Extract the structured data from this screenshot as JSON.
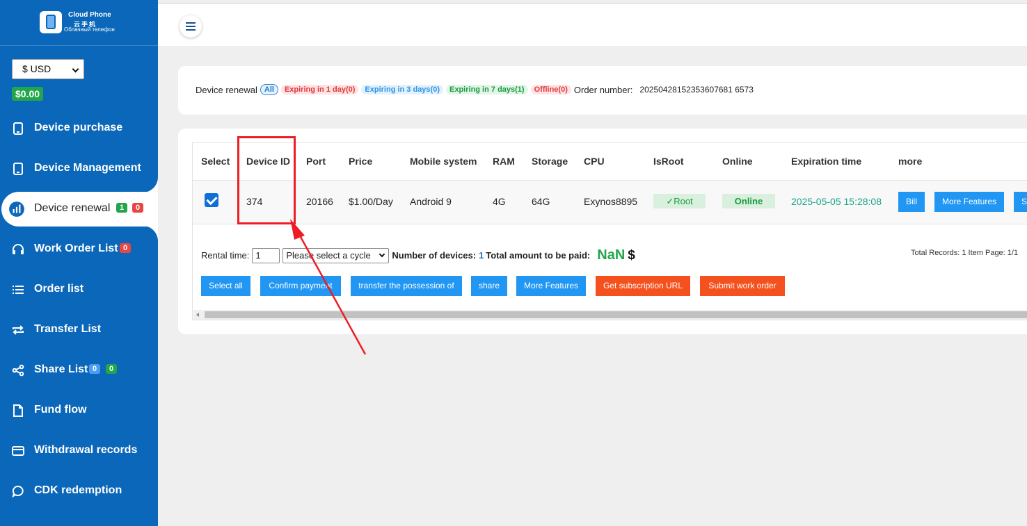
{
  "logo": {
    "line1": "Cloud Phone",
    "line2": "云手机",
    "line3": "Облачный телефон"
  },
  "sidebar": {
    "currency": "$ USD",
    "balance": "$0.00",
    "items": [
      {
        "label": "Device purchase",
        "icon": "tablet-icon"
      },
      {
        "label": "Device Management",
        "icon": "tablet-icon"
      },
      {
        "label": "Device renewal",
        "icon": "bar-chart-icon",
        "badges": [
          "1",
          "0"
        ]
      },
      {
        "label": "Work Order List",
        "icon": "headset-icon",
        "badges": [
          "0"
        ]
      },
      {
        "label": "Order list",
        "icon": "list-icon"
      },
      {
        "label": "Transfer List",
        "icon": "transfer-icon"
      },
      {
        "label": "Share List",
        "icon": "share-icon",
        "badges": [
          "0",
          "0"
        ]
      },
      {
        "label": "Fund flow",
        "icon": "file-icon"
      },
      {
        "label": "Withdrawal records",
        "icon": "card-icon"
      },
      {
        "label": "CDK redemption",
        "icon": "chat-icon"
      }
    ]
  },
  "filters": {
    "label": "Device renewal",
    "all": "All",
    "d1": "Expiring in 1 day(0)",
    "d3": "Expiring in 3 days(0)",
    "d7": "Expiring in 7 days(1)",
    "offline": "Offline(0)",
    "order_label": "Order number:",
    "order_value": "20250428152353607681 6573"
  },
  "table": {
    "headers": [
      "Select",
      "Device ID",
      "Port",
      "Price",
      "Mobile system",
      "RAM",
      "Storage",
      "CPU",
      "IsRoot",
      "Online",
      "Expiration time",
      "more"
    ],
    "row": {
      "device_id": "374",
      "port": "20166",
      "price": "$1.00/Day",
      "system": "Android 9",
      "ram": "4G",
      "storage": "64G",
      "cpu": "Exynos8895",
      "root": "✓Root",
      "online": "Online",
      "expiration": "2025-05-05 15:28:08",
      "actions": [
        "Bill",
        "More Features",
        "S"
      ]
    }
  },
  "footer": {
    "rental_label": "Rental time:",
    "rental_value": "1",
    "cycle_placeholder": "Please select a cycle",
    "devices_label": "Number of devices:",
    "devices_value": "1",
    "total_label": "Total amount to be paid:",
    "total_value": "NaN",
    "currency_sign": "$",
    "records": "Total Records: 1 Item Page: 1/1"
  },
  "actions": [
    "Select all",
    "Confirm payment",
    "transfer the possession of",
    "share",
    "More Features",
    "Get subscription URL",
    "Submit work order"
  ],
  "colors": {
    "sidebar": "#0b67b9",
    "primary_btn": "#2196f3",
    "orange_btn": "#f4511e",
    "success": "#22a64a",
    "annotation": "#ee1c24"
  }
}
